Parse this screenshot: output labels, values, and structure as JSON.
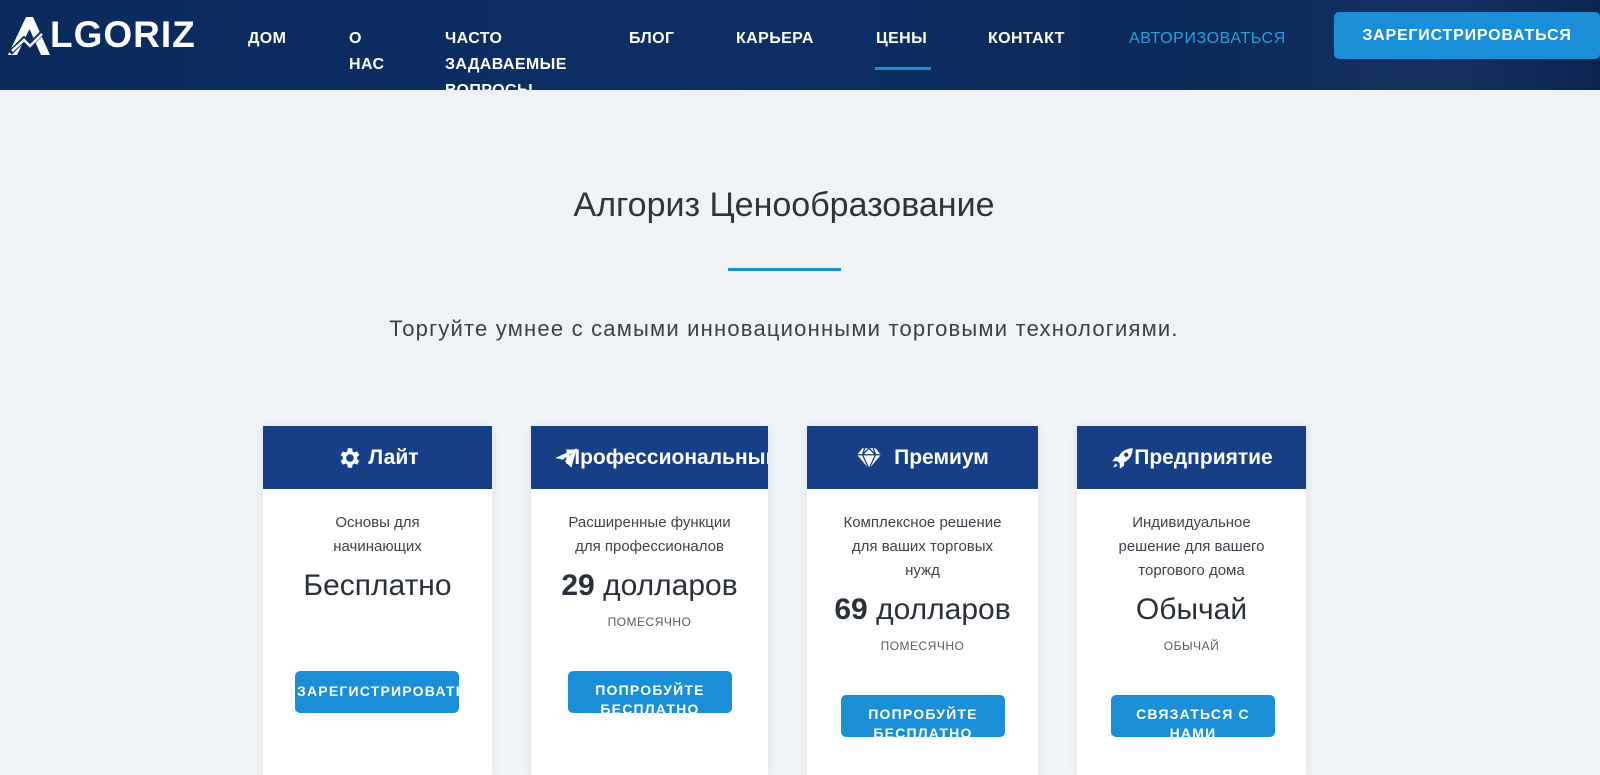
{
  "header": {
    "logo_text": "LGORIZ",
    "logo_icon": "algoriz-a-logo",
    "nav": [
      {
        "label": "ДОМ"
      },
      {
        "label": "О НАС"
      },
      {
        "label": "ЧАСТО ЗАДАВАЕМЫЕ ВОПРОСЫ"
      },
      {
        "label": "БЛОГ"
      },
      {
        "label": "КАРЬЕРА"
      },
      {
        "label": "ЦЕНЫ"
      },
      {
        "label": "КОНТАКТ"
      },
      {
        "label": "АВТОРИЗОВАТЬСЯ"
      }
    ],
    "register_label": "ЗАРЕГИСТРИРОВАТЬСЯ"
  },
  "main": {
    "title": "Алгориз Ценообразование",
    "subtitle": "Торгуйте умнее с самыми инновационными торговыми технологиями."
  },
  "plans": [
    {
      "name": "Лайт",
      "icon": "gear-icon",
      "description": "Основы для начинающих",
      "price_num": "",
      "price_text": "Бесплатно",
      "period": "",
      "button": "ЗАРЕГИСТРИРОВАТЬСЯ"
    },
    {
      "name": "Профессиональный",
      "icon": "paper-plane-icon",
      "description": "Расширенные функции для профессионалов",
      "price_num": "29",
      "price_text": "долларов",
      "period": "ПОМЕСЯЧНО",
      "button": "ПОПРОБУЙТЕ БЕСПЛАТНО"
    },
    {
      "name": "Премиум",
      "icon": "diamond-icon",
      "description": "Комплексное решение для ваших торговых нужд",
      "price_num": "69",
      "price_text": "долларов",
      "period": "ПОМЕСЯЧНО",
      "button": "ПОПРОБУЙТЕ БЕСПЛАТНО"
    },
    {
      "name": "Предприятие",
      "icon": "rocket-icon",
      "description": "Индивидуальное решение для вашего торгового дома",
      "price_num": "",
      "price_text": "Обычай",
      "period": "ОБЫЧАЙ",
      "button": "СВЯЗАТЬСЯ С НАМИ"
    }
  ],
  "colors": {
    "header_bg": "#0d2f66",
    "card_header_bg": "#163f85",
    "accent": "#1a8fd8",
    "page_bg": "#eff3f6"
  }
}
